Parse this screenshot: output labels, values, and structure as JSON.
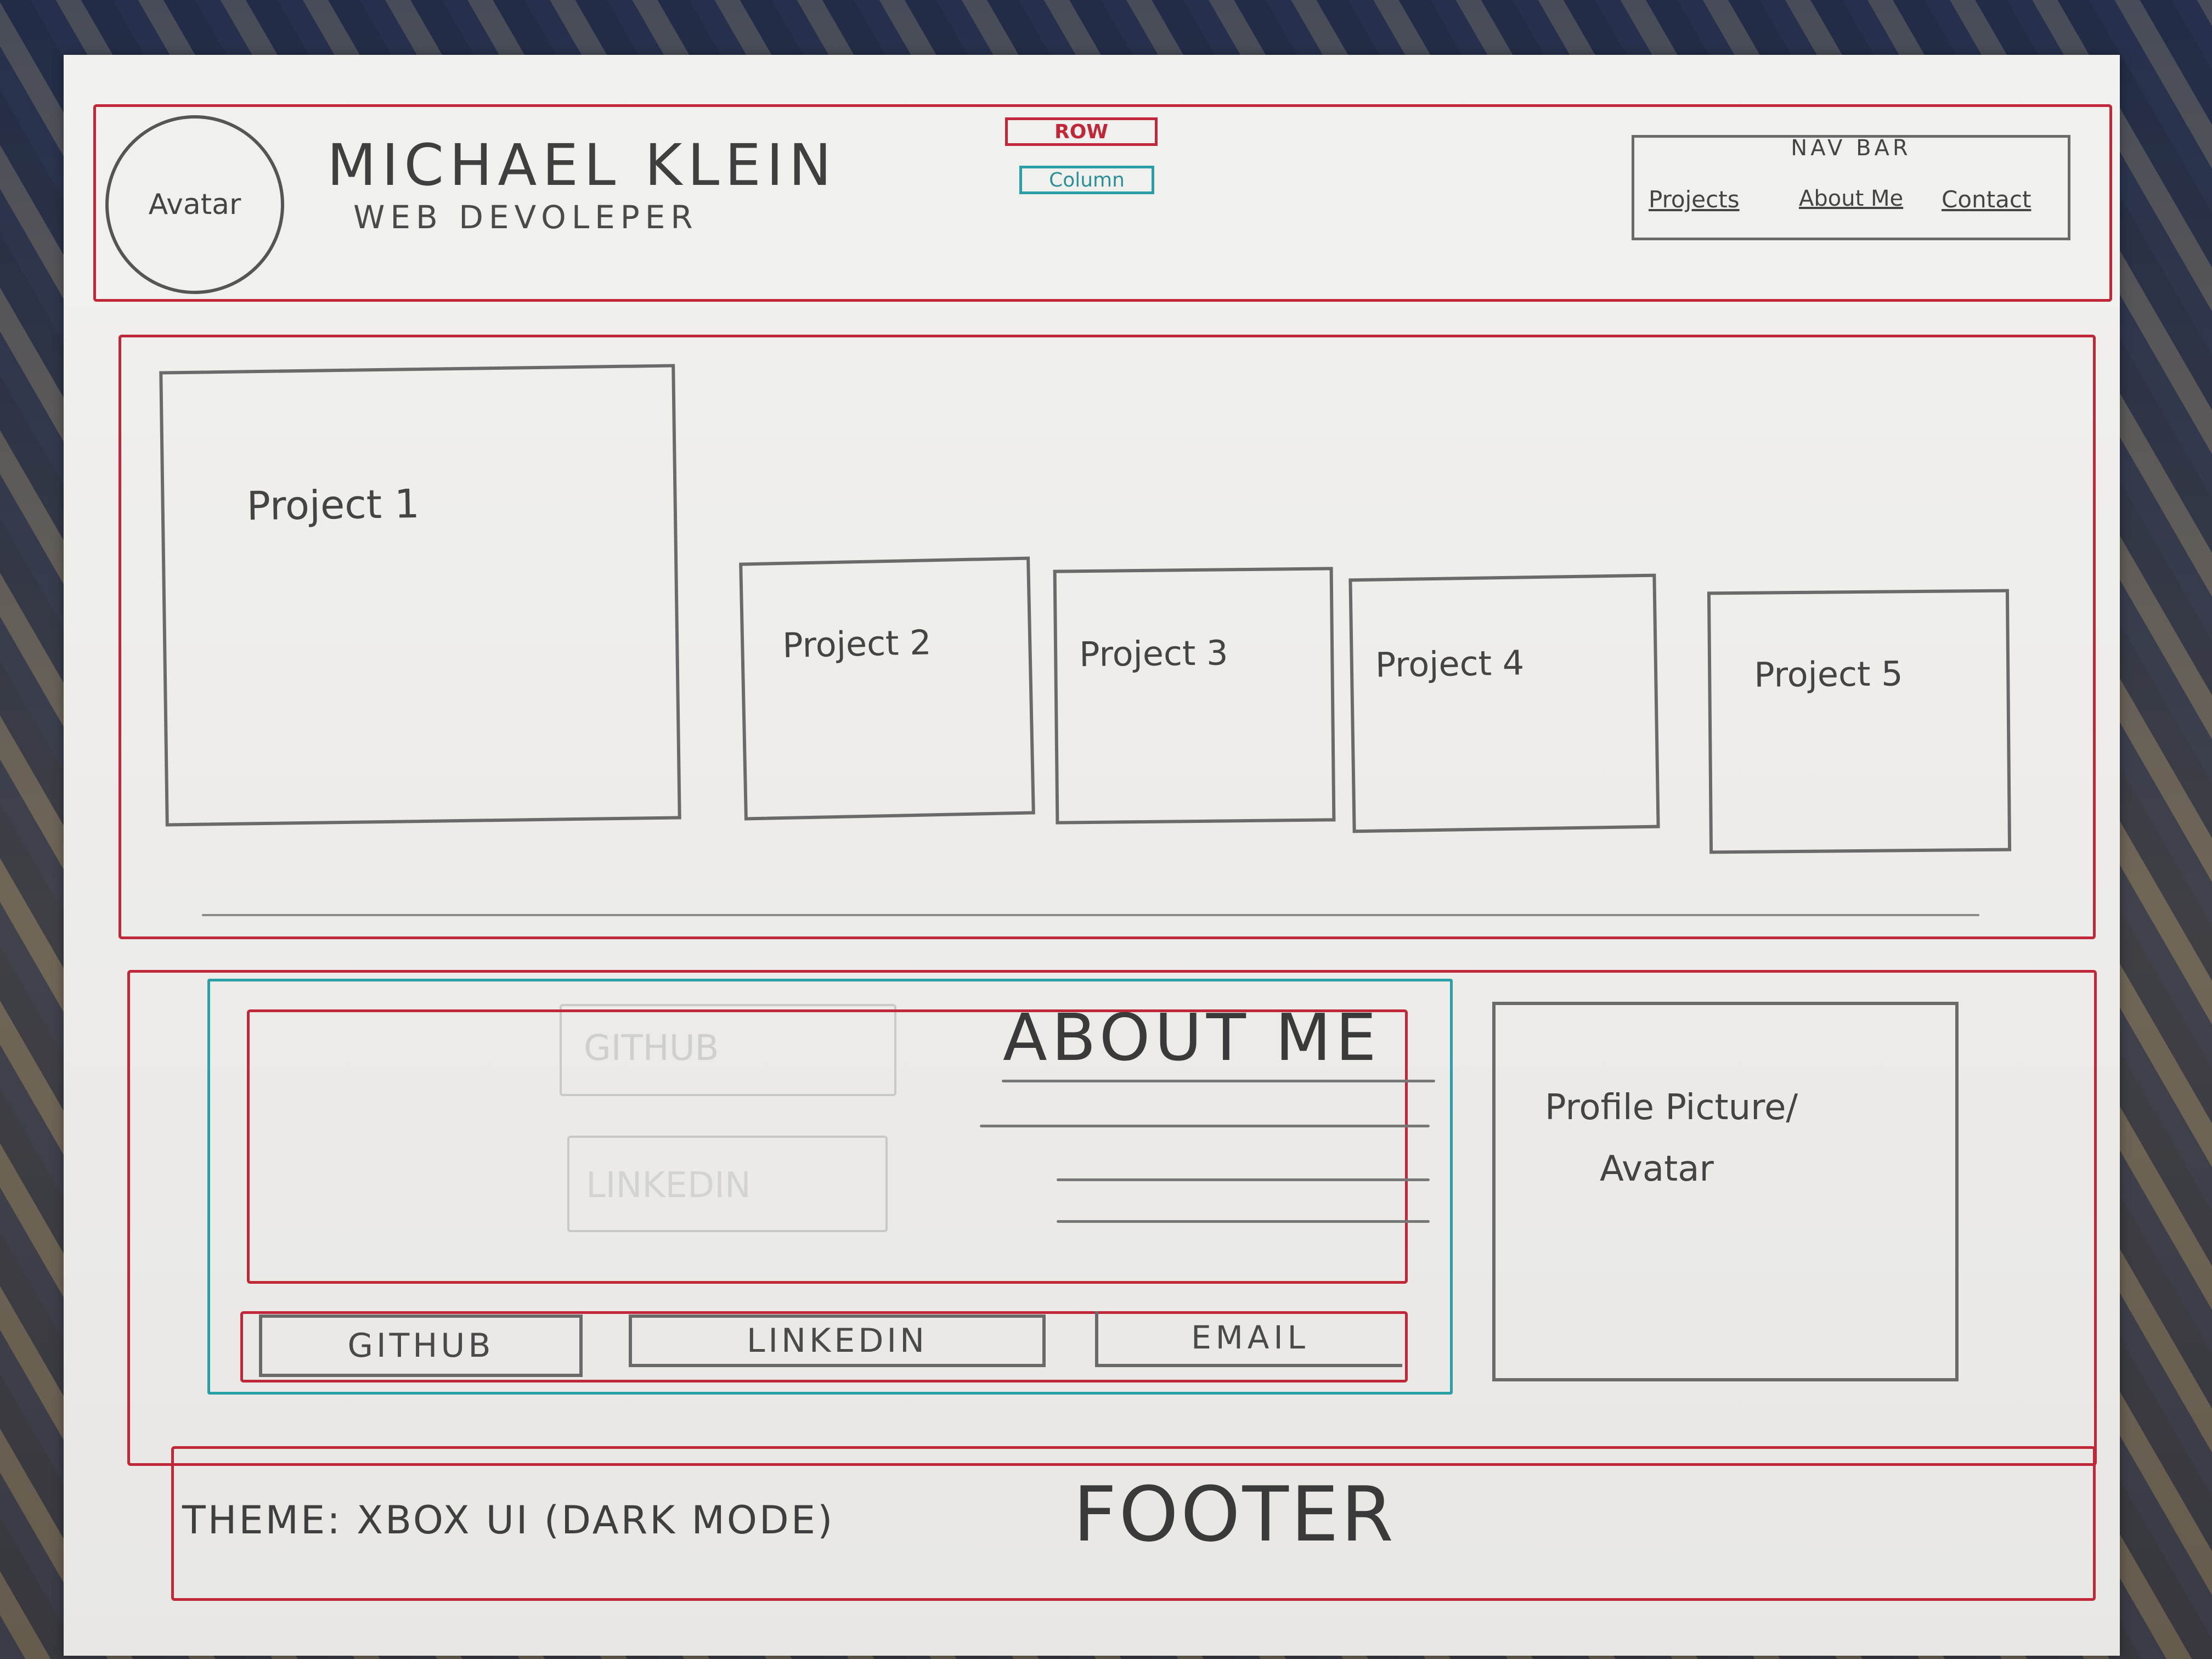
{
  "header": {
    "avatar_label": "Avatar",
    "name": "MICHAEL KLEIN",
    "subtitle": "WEB DEVOLEPER",
    "row_tag": "ROW",
    "column_tag": "Column",
    "nav": {
      "title": "NAV BAR",
      "items": [
        "Projects",
        "About Me",
        "Contact"
      ]
    }
  },
  "projects": {
    "items": [
      "Project 1",
      "Project 2",
      "Project 3",
      "Project 4",
      "Project 5"
    ]
  },
  "about": {
    "heading": "ABOUT ME",
    "buttons": [
      "GITHUB",
      "LINKEDIN",
      "EMAIL"
    ],
    "faint_labels": [
      "GITHUB",
      "LINKEDIN"
    ],
    "profile_label_line1": "Profile Picture/",
    "profile_label_line2": "Avatar"
  },
  "footer": {
    "theme": "THEME: XBOX UI (DARK MODE)",
    "label": "FOOTER"
  },
  "colors": {
    "row_border": "#c0283a",
    "column_border": "#2a9fa8",
    "pencil": "#6a6a6a"
  }
}
